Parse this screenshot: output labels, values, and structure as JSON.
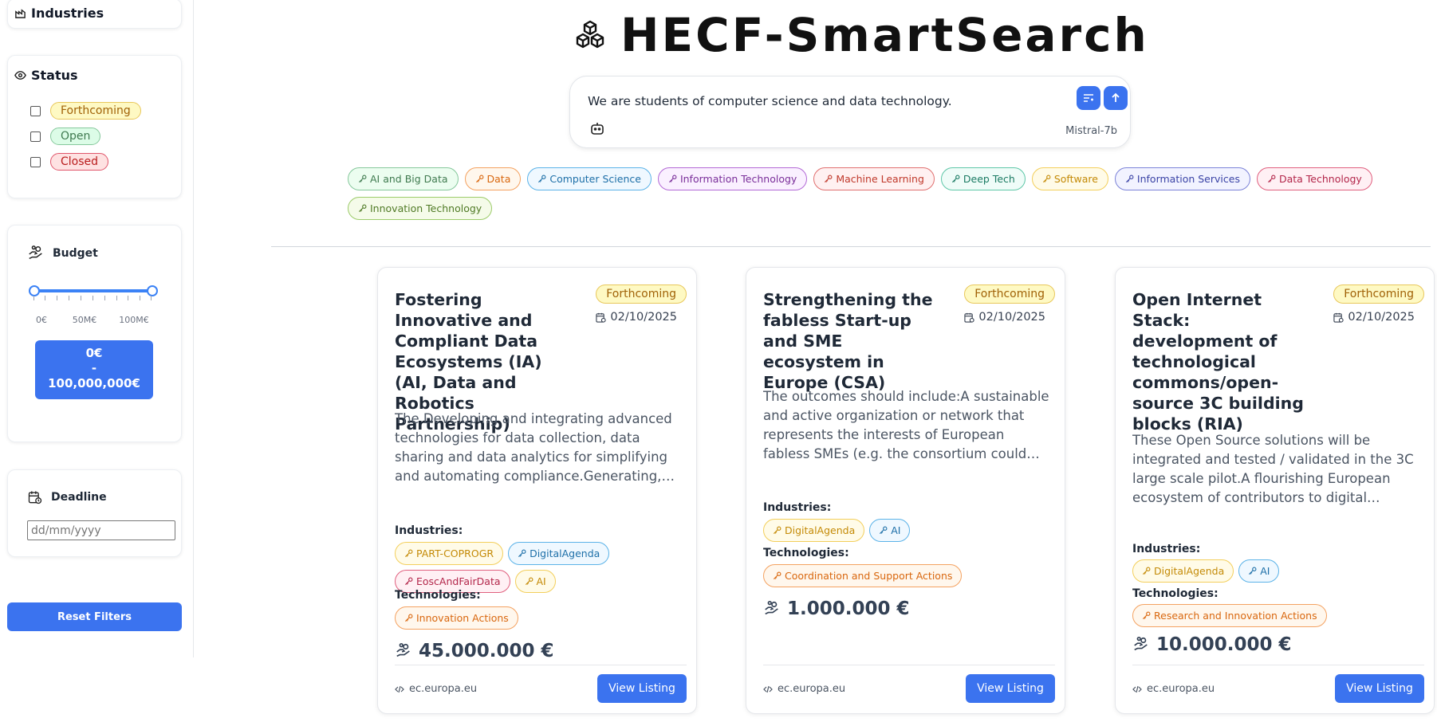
{
  "sidebar": {
    "industries_title": "Industries",
    "status_title": "Status",
    "status_options": [
      "Forthcoming",
      "Open",
      "Closed"
    ],
    "budget_title": "Budget",
    "budget_ticks": [
      "0€",
      "50M€",
      "100M€"
    ],
    "budget_range_min": "0€",
    "budget_range_sep": "-",
    "budget_range_max": "100,000,000€",
    "deadline_title": "Deadline",
    "deadline_placeholder": "dd/mm/yyyy",
    "reset_label": "Reset Filters"
  },
  "header": {
    "title": "HECF-SmartSearch"
  },
  "search": {
    "query": "We are students of computer science and data technology.",
    "model": "Mistral-7b"
  },
  "keywords": [
    {
      "label": "AI and Big Data",
      "color": "green"
    },
    {
      "label": "Data",
      "color": "orange"
    },
    {
      "label": "Computer Science",
      "color": "blue"
    },
    {
      "label": "Information Technology",
      "color": "purple"
    },
    {
      "label": "Machine Learning",
      "color": "red"
    },
    {
      "label": "Deep Tech",
      "color": "teal"
    },
    {
      "label": "Software",
      "color": "yellow"
    },
    {
      "label": "Information Services",
      "color": "indigo"
    },
    {
      "label": "Data Technology",
      "color": "pink"
    },
    {
      "label": "Innovation Technology",
      "color": "olive"
    }
  ],
  "labels": {
    "industries": "Industries:",
    "technologies": "Technologies:",
    "view_listing": "View Listing"
  },
  "cards": [
    {
      "title": "Fostering Innovative and Compliant Data Ecosystems (IA) (AI, Data and Robotics Partnership)",
      "status": "Forthcoming",
      "date": "02/10/2025",
      "description": "The Developing and integrating advanced technologies for data collection, data sharing and data analytics for simplifying and automating compliance.Generating, managing, and leveraging synthetic data to enhance data ecosystems.",
      "industries": [
        {
          "label": "PART-COPROGR",
          "color": "yellow"
        },
        {
          "label": "DigitalAgenda",
          "color": "blue"
        },
        {
          "label": "EoscAndFairData",
          "color": "pink"
        },
        {
          "label": "AI",
          "color": "yellow"
        }
      ],
      "technologies": [
        {
          "label": "Innovation Actions",
          "color": "orange"
        }
      ],
      "budget": "45.000.000 €",
      "source": "ec.europa.eu"
    },
    {
      "title": "Strengthening the fabless Start-up and SME ecosystem in Europe (CSA)",
      "status": "Forthcoming",
      "date": "02/10/2025",
      "description": "The outcomes should include:A sustainable and active organization or network that represents the interests of European fabless SMEs (e.g. the consortium could form an open industry association).A comprehensive mapping of the fabless ecosystem.",
      "industries": [
        {
          "label": "DigitalAgenda",
          "color": "yellow"
        },
        {
          "label": "AI",
          "color": "blue"
        }
      ],
      "technologies": [
        {
          "label": "Coordination and Support Actions",
          "color": "orange"
        }
      ],
      "budget": "1.000.000 €",
      "source": "ec.europa.eu"
    },
    {
      "title": "Open Internet Stack: development of technological commons/open-source 3C building blocks (RIA)",
      "status": "Forthcoming",
      "date": "02/10/2025",
      "description": "These Open Source solutions will be integrated and tested / validated in the 3C large scale pilot.A flourishing European ecosystem of contributors to digital commons– e.g., individuals, SMEs, academic institutions and communities.",
      "industries": [
        {
          "label": "DigitalAgenda",
          "color": "yellow"
        },
        {
          "label": "AI",
          "color": "blue"
        }
      ],
      "technologies": [
        {
          "label": "Research and Innovation Actions",
          "color": "orange"
        }
      ],
      "budget": "10.000.000 €",
      "source": "ec.europa.eu"
    }
  ]
}
